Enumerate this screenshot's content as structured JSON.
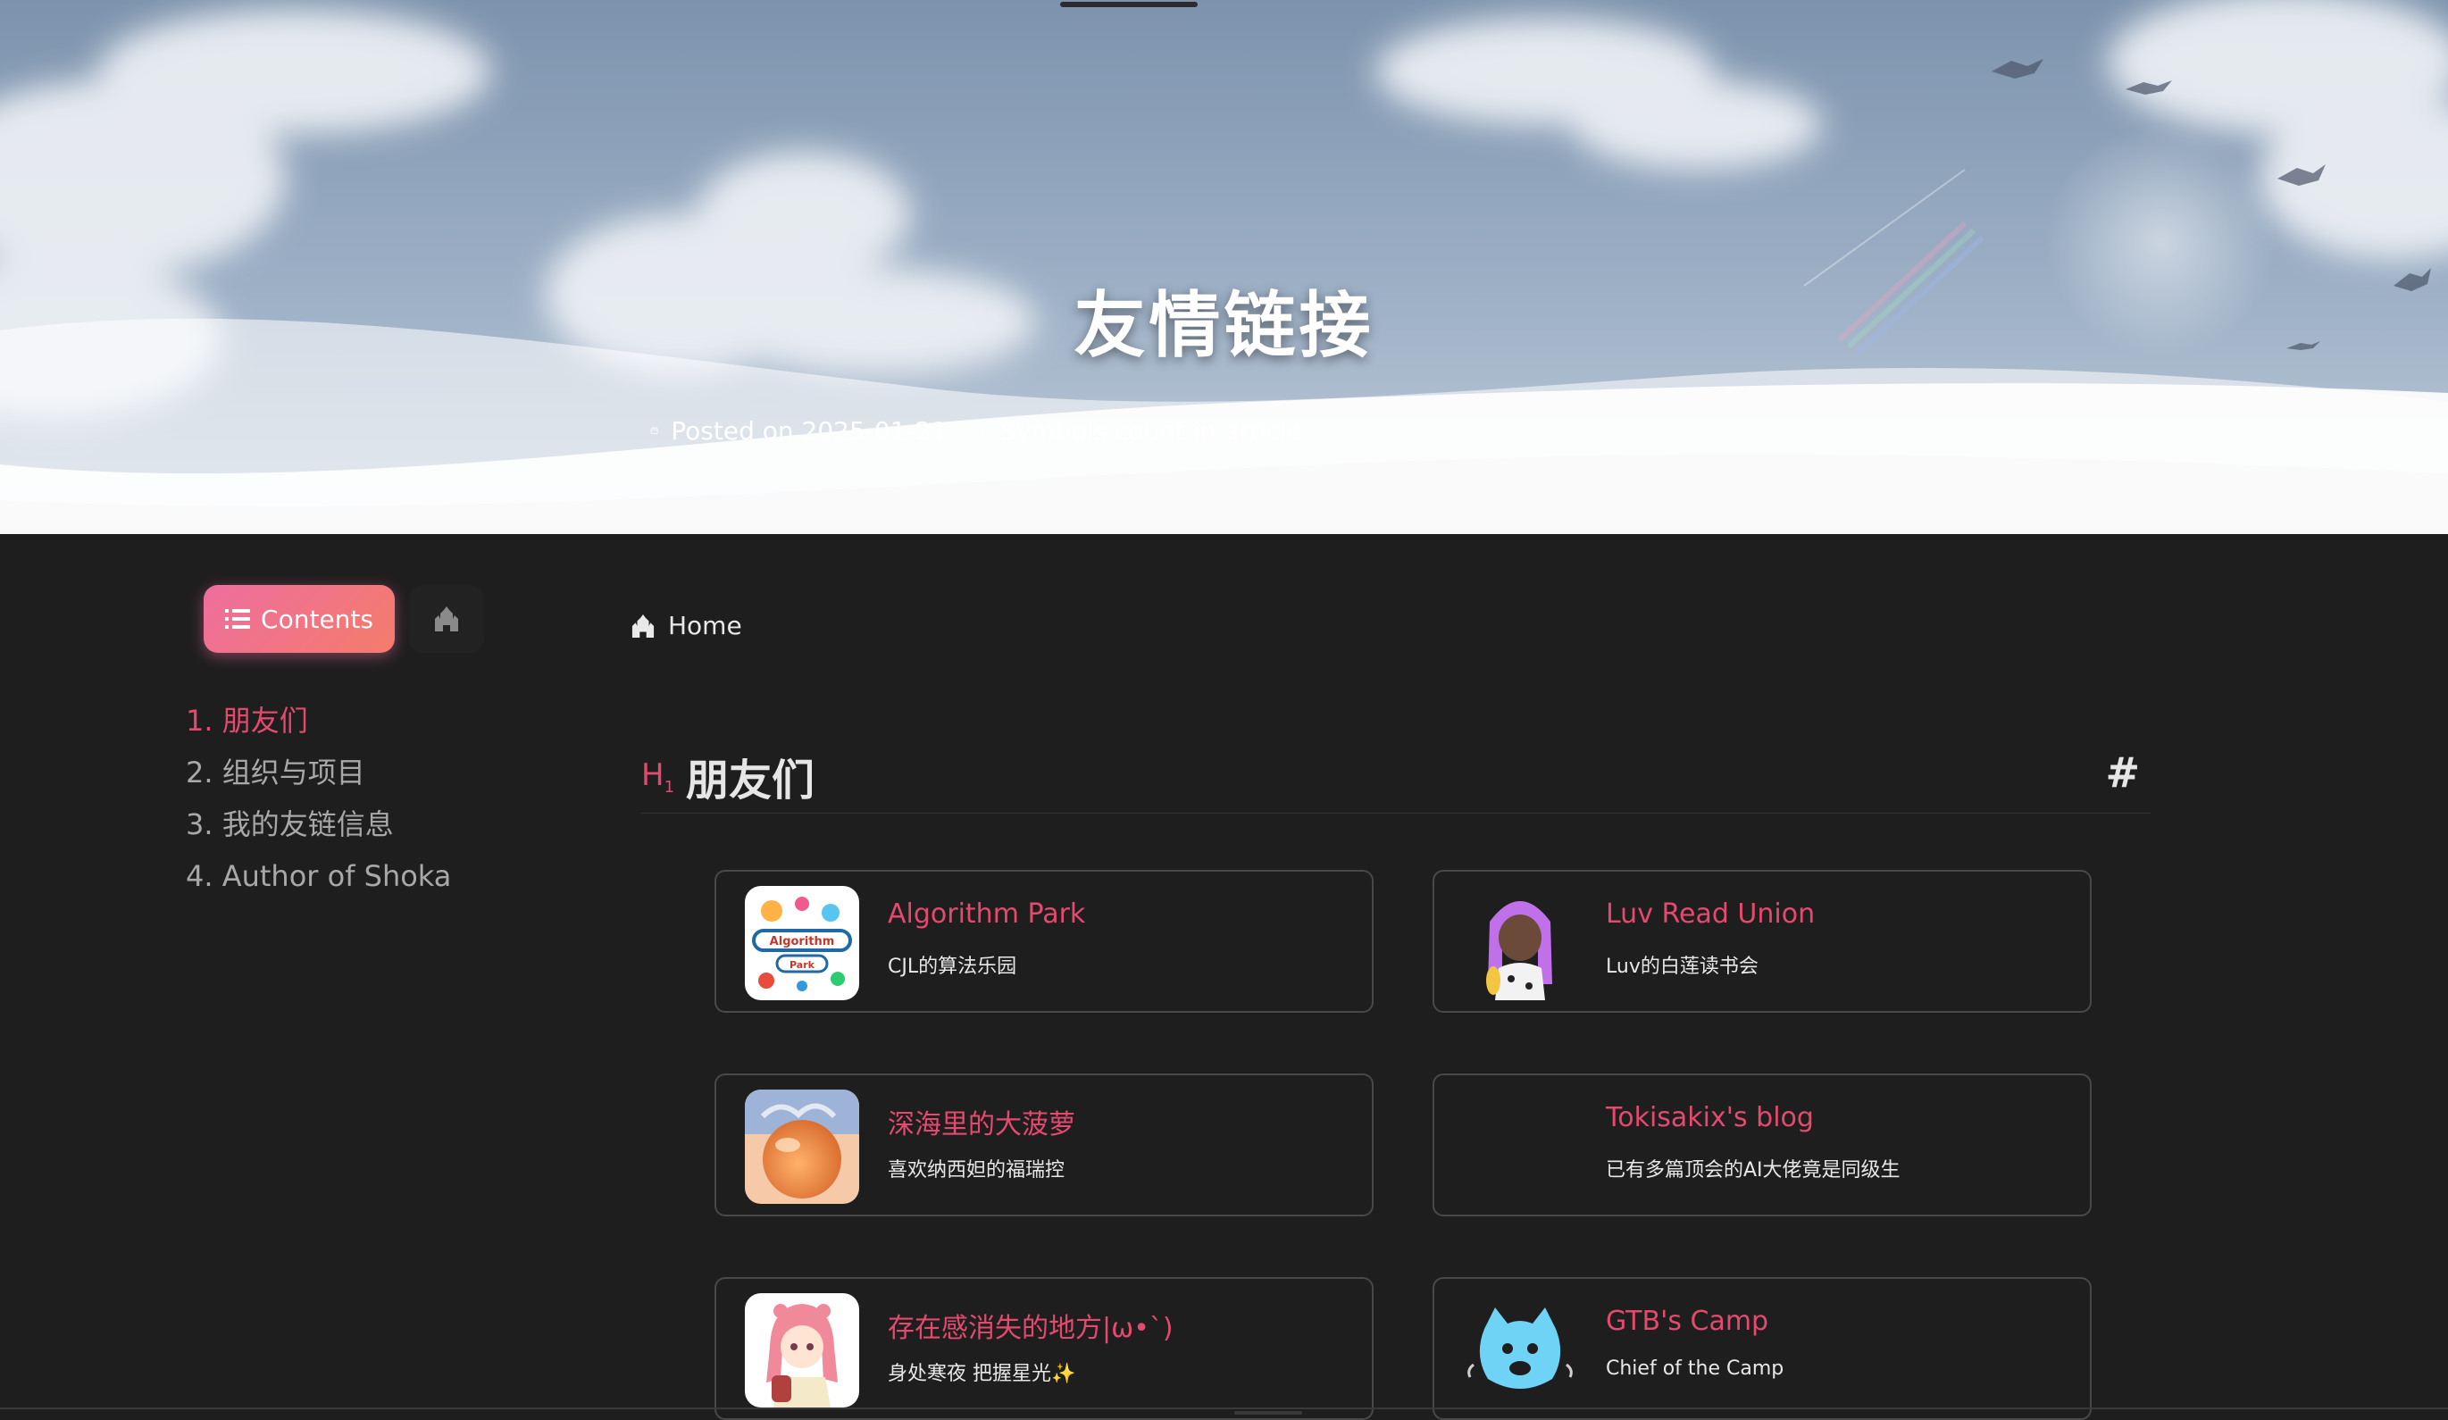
{
  "hero": {
    "title": "友情链接",
    "posted_label": "Posted on 2025-01-21",
    "symbols_label": "Symbols count in article"
  },
  "sidebar": {
    "tabs": {
      "contents": "Contents",
      "overview_icon": "castle-icon"
    },
    "toc": [
      {
        "label": "1. 朋友们",
        "active": true
      },
      {
        "label": "2. 组织与项目",
        "active": false
      },
      {
        "label": "3. 我的友链信息",
        "active": false
      },
      {
        "label": "4. Author of Shoka",
        "active": false
      }
    ]
  },
  "breadcrumb": {
    "home": "Home"
  },
  "section": {
    "marker": "H",
    "marker_sub": "1",
    "title": "朋友们",
    "anchor": "#"
  },
  "links": [
    {
      "name": "Algorithm Park",
      "desc": "CJL的算法乐园",
      "avatar": "algorithm-park-logo"
    },
    {
      "name": "Luv Read Union",
      "desc": "Luv的白莲读书会",
      "avatar": "anime-girl-purple-hair"
    },
    {
      "name": "深海里的大菠萝",
      "desc": "喜欢纳西妲的福瑞控",
      "avatar": "orange-fruit-art"
    },
    {
      "name": "Tokisakix's blog",
      "desc": "已有多篇顶会的AI大佬竟是同级生",
      "avatar": ""
    },
    {
      "name": "存在感消失的地方|ω•`)",
      "desc": "身处寒夜 把握星光✨",
      "avatar": "anime-girl-pink-hair"
    },
    {
      "name": "GTB's Camp",
      "desc": "Chief of the Camp",
      "avatar": "blue-cat-mascot"
    }
  ],
  "colors": {
    "accent": "#e34a6e",
    "background": "#1f1e1f",
    "card_border": "#4a494a"
  }
}
